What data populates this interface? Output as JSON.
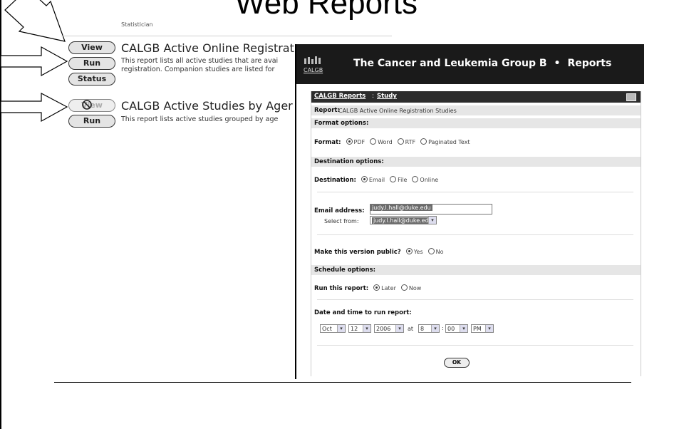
{
  "slide": {
    "title": "Web Reports"
  },
  "report_list": {
    "cut_text": "Statistician",
    "reports": [
      {
        "buttons": [
          "View",
          "Run",
          "Status"
        ],
        "title": "CALGB Active Online Registrat",
        "desc_line1": "This report lists all active studies that are avai",
        "desc_line2": "registration. Companion studies are listed for"
      },
      {
        "buttons": [
          "View",
          "Run"
        ],
        "title": "CALGB Active Studies by Ager",
        "desc_line1": "This report lists active studies grouped by age"
      }
    ]
  },
  "dialog": {
    "logo_text": "CALGB",
    "header_org": "The Cancer and Leukemia Group B",
    "header_bullet": "•",
    "header_section": "Reports",
    "breadcrumb": {
      "link1": "CALGB Reports",
      "sep": ":",
      "link2": "Study"
    },
    "report_label": "Report:",
    "report_value": "CALGB Active Online Registration Studies",
    "format_section": "Format options:",
    "format_label": "Format:",
    "format_options": [
      "PDF",
      "Word",
      "RTF",
      "Paginated Text"
    ],
    "format_selected": "PDF",
    "destination_section": "Destination options:",
    "destination_label": "Destination:",
    "destination_options": [
      "Email",
      "File",
      "Online"
    ],
    "destination_selected": "Email",
    "email_label": "Email address:",
    "email_value": "judy.l.hall@duke.edu",
    "select_from_label": "Select from:",
    "select_from_value": "judy.l.hall@duke.edu",
    "public_label": "Make this version public?",
    "public_options": [
      "Yes",
      "No"
    ],
    "public_selected": "Yes",
    "schedule_section": "Schedule options:",
    "run_label": "Run this report:",
    "run_options": [
      "Later",
      "Now"
    ],
    "run_selected": "Later",
    "datetime_label": "Date and time to run report:",
    "date": {
      "month": "Oct",
      "day": "12",
      "year": "2006",
      "at": "at",
      "hour": "8",
      "colon": ":",
      "minute": "00",
      "ampm": "PM"
    },
    "ok_label": "OK"
  },
  "colors": {
    "header_bg": "#1a1a1a",
    "section_bg": "#e6e6e6",
    "selection_bg": "#6b6b6b"
  }
}
